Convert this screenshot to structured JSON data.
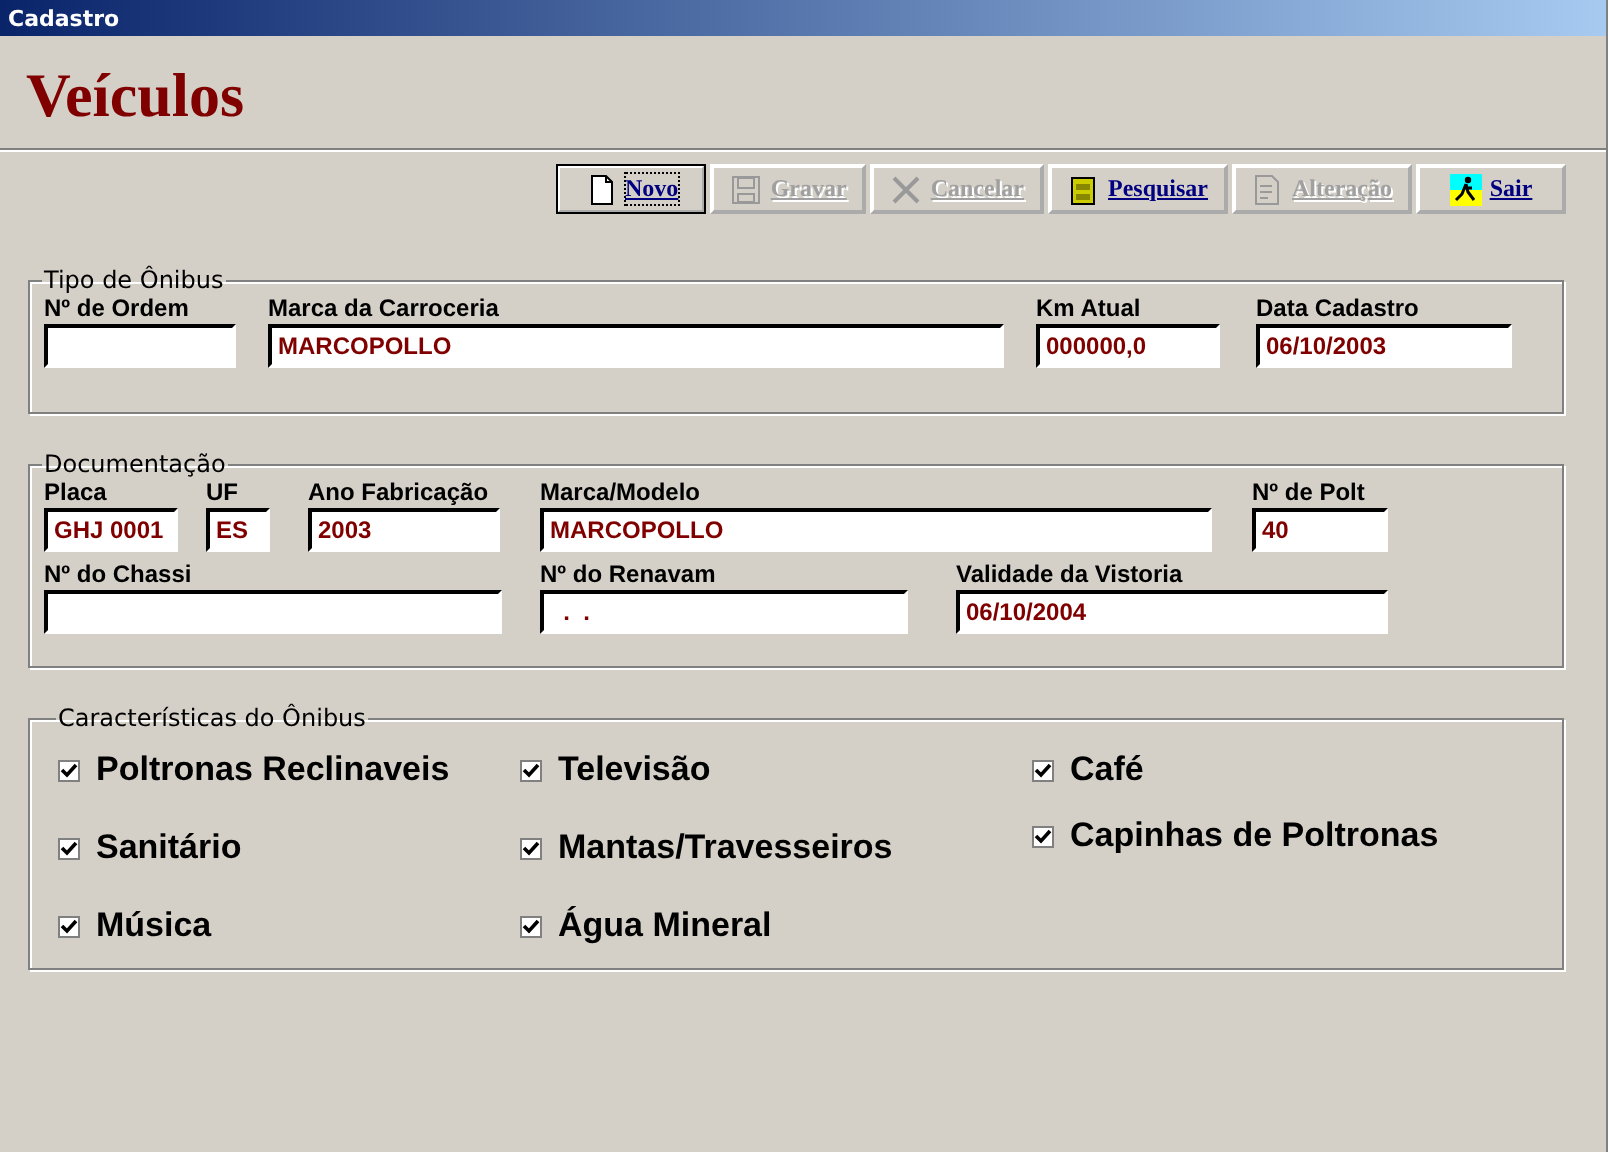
{
  "window": {
    "title": "Cadastro"
  },
  "heading": "Veículos",
  "toolbar": [
    {
      "label": "Novo",
      "kind": "new",
      "disabled": false,
      "focused": true
    },
    {
      "label": "Gravar",
      "kind": "save",
      "disabled": true,
      "focused": false
    },
    {
      "label": "Cancelar",
      "kind": "cancel",
      "disabled": true,
      "focused": false
    },
    {
      "label": "Pesquisar",
      "kind": "search",
      "disabled": false,
      "focused": false
    },
    {
      "label": "Alteração",
      "kind": "edit",
      "disabled": true,
      "focused": false
    },
    {
      "label": "Sair",
      "kind": "exit",
      "disabled": false,
      "focused": false
    }
  ],
  "groups": [
    {
      "title": "Tipo de Ônibus",
      "fields": [
        {
          "label": "Nº de Ordem"
        },
        {
          "label": "Marca da Carroceria",
          "value": "MARCOPOLLO"
        },
        {
          "label": "Km Atual",
          "value": "000000,0"
        },
        {
          "label": "Data Cadastro",
          "value": "06/10/2003"
        }
      ]
    },
    {
      "title": "Documentação",
      "fields": [
        {
          "label": "Placa",
          "value": "GHJ 0001"
        },
        {
          "label": "UF",
          "value": "ES"
        },
        {
          "label": "Ano Fabricação",
          "value": "2003"
        },
        {
          "label": "Marca/Modelo",
          "value": "MARCOPOLLO"
        },
        {
          "label": "Nº de Polt",
          "value": "40"
        },
        {
          "label": "Nº do Chassi"
        },
        {
          "label": "Nº do Renavam",
          "value": "  .  ."
        },
        {
          "label": "Validade da Vistoria",
          "value": "06/10/2004"
        }
      ]
    }
  ],
  "features": {
    "title": "Características do Ônibus",
    "columns": [
      [
        {
          "label": "Poltronas Reclinaveis",
          "checked": true
        },
        {
          "label": "Sanitário",
          "checked": true
        },
        {
          "label": "Música",
          "checked": true
        }
      ],
      [
        {
          "label": "Televisão",
          "checked": true
        },
        {
          "label": "Mantas/Travesseiros",
          "checked": true
        },
        {
          "label": "Água Mineral",
          "checked": true
        }
      ],
      [
        {
          "label": "Café",
          "checked": true
        },
        {
          "label": "Capinhas de Poltronas",
          "checked": true
        }
      ]
    ]
  }
}
